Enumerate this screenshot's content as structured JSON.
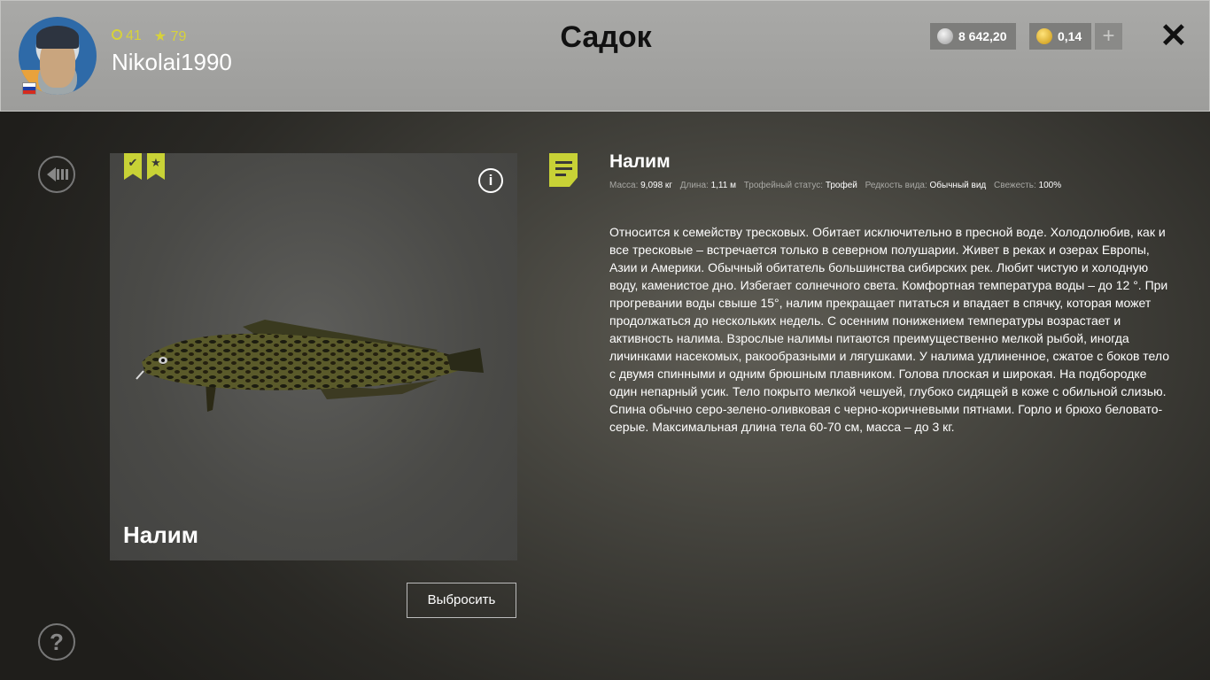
{
  "header": {
    "title": "Садок",
    "username": "Nikolai1990",
    "level": "41",
    "rating": "79",
    "silver": "8 642,20",
    "gold": "0,14",
    "plus": "+",
    "close": "✕"
  },
  "fish": {
    "name": "Налим",
    "info": "i",
    "discard_label": "Выбросить"
  },
  "details": {
    "title": "Налим",
    "props": [
      {
        "label": "Масса:",
        "value": "9,098 кг"
      },
      {
        "label": "Длина:",
        "value": "1,11 м"
      },
      {
        "label": "Трофейный статус:",
        "value": "Трофей"
      },
      {
        "label": "Редкость вида:",
        "value": "Обычный вид"
      },
      {
        "label": "Свежесть:",
        "value": "100%"
      }
    ],
    "description": "Относится к семейству тресковых. Обитает исключительно в пресной воде. Холодолюбив, как и все тресковые – встречается только в северном полушарии. Живет в реках и озерах Европы, Азии и Америки. Обычный обитатель большинства сибирских рек. Любит чистую и холодную воду, каменистое дно. Избегает солнечного света. Комфортная температура воды – до 12 °. При прогревании воды свыше 15°, налим прекращает питаться и впадает в спячку, которая может продолжаться до нескольких недель. С осенним понижением температуры возрастает и активность налима. Взрослые налимы питаются преимущественно мелкой рыбой, иногда личинками насекомых, ракообразными и лягушками. У налима удлиненное, сжатое с боков тело с двумя спинными и одним брюшным плавником. Голова плоская и широкая. На подбородке один непарный усик. Тело покрыто мелкой чешуей, глубоко сидящей в коже с обильной слизью. Спина обычно серо-зелено-оливковая с черно-коричневыми пятнами. Горло и брюхо беловато-серые. Максимальная длина тела 60-70 см, масса – до 3 кг."
  },
  "colors": {
    "accent": "#c8d236",
    "header_bg": "#a9a9a7"
  }
}
